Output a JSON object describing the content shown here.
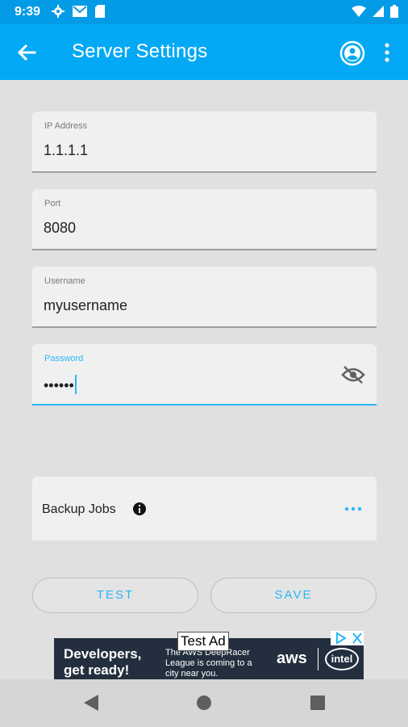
{
  "status_bar": {
    "time": "9:39",
    "left_icons": [
      "gear-icon",
      "gmail-icon",
      "sd-card-icon"
    ],
    "right_icons": [
      "wifi-icon",
      "signal-icon",
      "battery-icon"
    ]
  },
  "app_bar": {
    "title": "Server Settings",
    "background_color": "#03a9f4",
    "icons": [
      "back-arrow-icon",
      "account-circle-icon",
      "more-vert-icon"
    ]
  },
  "form": {
    "ip_address": {
      "label": "IP Address",
      "value": "1.1.1.1"
    },
    "port": {
      "label": "Port",
      "value": "8080"
    },
    "username": {
      "label": "Username",
      "value": "myusername"
    },
    "password": {
      "label": "Password",
      "value": "••••••",
      "focused": true
    }
  },
  "backup_jobs": {
    "label": "Backup Jobs",
    "icons": [
      "info-icon",
      "more-horiz-icon"
    ]
  },
  "buttons": {
    "test_label": "TEST",
    "save_label": "SAVE"
  },
  "ad": {
    "label": "Test Ad",
    "headline": "Developers, get ready!",
    "body": "The AWS DeepRacer League is coming to a city near you.",
    "brand_1": "aws",
    "brand_2": "intel"
  },
  "colors": {
    "accent": "#29b6f6",
    "app_bar": "#03a9f4",
    "status_bar": "#039be5",
    "background": "#e0e0e0"
  }
}
